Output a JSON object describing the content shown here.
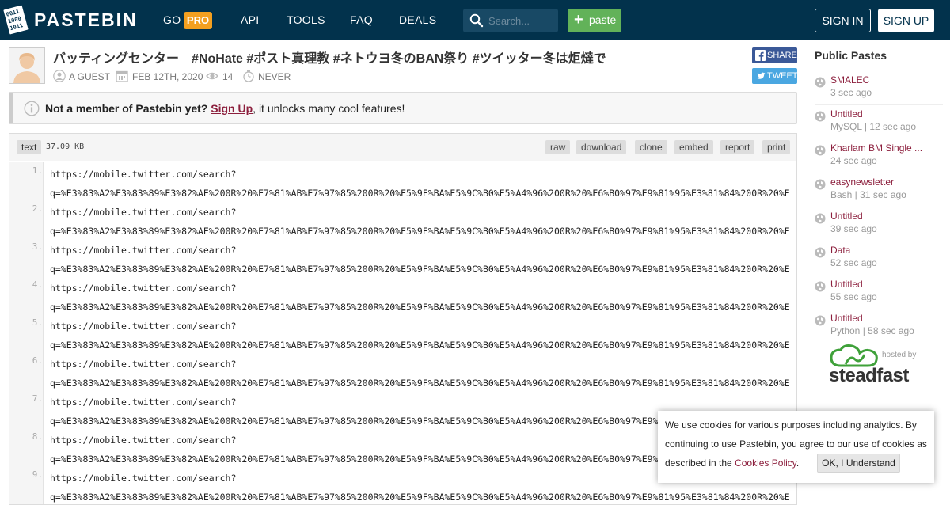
{
  "header": {
    "logo_text": "PASTEBIN",
    "nav": {
      "go": "GO",
      "pro": "PRO",
      "api": "API",
      "tools": "TOOLS",
      "faq": "FAQ",
      "deals": "DEALS"
    },
    "search_placeholder": "Search...",
    "paste_label": "paste",
    "sign_in": "SIGN IN",
    "sign_up": "SIGN UP"
  },
  "paste": {
    "title": "バッティングセンター　#NoHate #ポスト真理教 #ネトウヨ冬のBAN祭り #ツイッター冬は炬燵で",
    "author": "A GUEST",
    "date": "FEB 12TH, 2020",
    "views": "14",
    "expires": "NEVER",
    "share_label": "SHARE",
    "tweet_label": "TWEET"
  },
  "notice": {
    "prefix": "Not a member of Pastebin yet?",
    "link": "Sign Up",
    "suffix": ", it unlocks many cool features!"
  },
  "code": {
    "language": "text",
    "size": "37.09 KB",
    "tools": [
      "raw",
      "download",
      "clone",
      "embed",
      "report",
      "print"
    ],
    "lines": [
      {
        "num": "1.",
        "text": "https://mobile.twitter.com/search?\nq=%E3%83%A2%E3%83%89%E3%82%AE%200R%20%E7%81%AB%E7%97%85%200R%20%E5%9F%BA%E5%9C%B0%E5%A4%96%200R%20%E6%B0%97%E9%81%95%E3%81%84%200R%20%E"
      },
      {
        "num": "2.",
        "text": "https://mobile.twitter.com/search?\nq=%E3%83%A2%E3%83%89%E3%82%AE%200R%20%E7%81%AB%E7%97%85%200R%20%E5%9F%BA%E5%9C%B0%E5%A4%96%200R%20%E6%B0%97%E9%81%95%E3%81%84%200R%20%E"
      },
      {
        "num": "3.",
        "text": "https://mobile.twitter.com/search?\nq=%E3%83%A2%E3%83%89%E3%82%AE%200R%20%E7%81%AB%E7%97%85%200R%20%E5%9F%BA%E5%9C%B0%E5%A4%96%200R%20%E6%B0%97%E9%81%95%E3%81%84%200R%20%E"
      },
      {
        "num": "4.",
        "text": "https://mobile.twitter.com/search?\nq=%E3%83%A2%E3%83%89%E3%82%AE%200R%20%E7%81%AB%E7%97%85%200R%20%E5%9F%BA%E5%9C%B0%E5%A4%96%200R%20%E6%B0%97%E9%81%95%E3%81%84%200R%20%E"
      },
      {
        "num": "5.",
        "text": "https://mobile.twitter.com/search?\nq=%E3%83%A2%E3%83%89%E3%82%AE%200R%20%E7%81%AB%E7%97%85%200R%20%E5%9F%BA%E5%9C%B0%E5%A4%96%200R%20%E6%B0%97%E9%81%95%E3%81%84%200R%20%E"
      },
      {
        "num": "6.",
        "text": "https://mobile.twitter.com/search?\nq=%E3%83%A2%E3%83%89%E3%82%AE%200R%20%E7%81%AB%E7%97%85%200R%20%E5%9F%BA%E5%9C%B0%E5%A4%96%200R%20%E6%B0%97%E9%81%95%E3%81%84%200R%20%E"
      },
      {
        "num": "7.",
        "text": "https://mobile.twitter.com/search?\nq=%E3%83%A2%E3%83%89%E3%82%AE%200R%20%E7%81%AB%E7%97%85%200R%20%E5%9F%BA%E5%9C%B0%E5%A4%96%200R%20%E6%B0%97%E9%81%95%E3%81%84%200R%20%E"
      },
      {
        "num": "8.",
        "text": "https://mobile.twitter.com/search?\nq=%E3%83%A2%E3%83%89%E3%82%AE%200R%20%E7%81%AB%E7%97%85%200R%20%E5%9F%BA%E5%9C%B0%E5%A4%96%200R%20%E6%B0%97%E9%81%95%E3%81%84%200R%20%E"
      },
      {
        "num": "9.",
        "text": "https://mobile.twitter.com/search?\nq=%E3%83%A2%E3%83%89%E3%82%AE%200R%20%E7%81%AB%E7%97%85%200R%20%E5%9F%BA%E5%9C%B0%E5%A4%96%200R%20%E6%B0%97%E9%81%95%E3%81%84%200R%20%E"
      }
    ]
  },
  "sidebar": {
    "title": "Public Pastes",
    "items": [
      {
        "name": "SMALEC",
        "sub": "3 sec ago"
      },
      {
        "name": "Untitled",
        "sub": "MySQL | 12 sec ago"
      },
      {
        "name": "Kharlam BM Single ...",
        "sub": "24 sec ago"
      },
      {
        "name": "easynewsletter",
        "sub": "Bash | 31 sec ago"
      },
      {
        "name": "Untitled",
        "sub": "39 sec ago"
      },
      {
        "name": "Data",
        "sub": "52 sec ago"
      },
      {
        "name": "Untitled",
        "sub": "55 sec ago"
      },
      {
        "name": "Untitled",
        "sub": "Python | 58 sec ago"
      }
    ],
    "hosted_by": "hosted by",
    "host_name": "steadfast"
  },
  "cookie": {
    "text": "We use cookies for various purposes including analytics. By continuing to use Pastebin, you agree to our use of cookies as described in the",
    "link": "Cookies Policy",
    "after": ".",
    "button": "OK, I Understand"
  },
  "colors": {
    "header_bg": "#02324c",
    "pro_badge": "#f4a020",
    "paste_btn": "#62b259",
    "link": "#8c1f3d",
    "facebook": "#3b5998",
    "twitter": "#4aa7e1"
  }
}
